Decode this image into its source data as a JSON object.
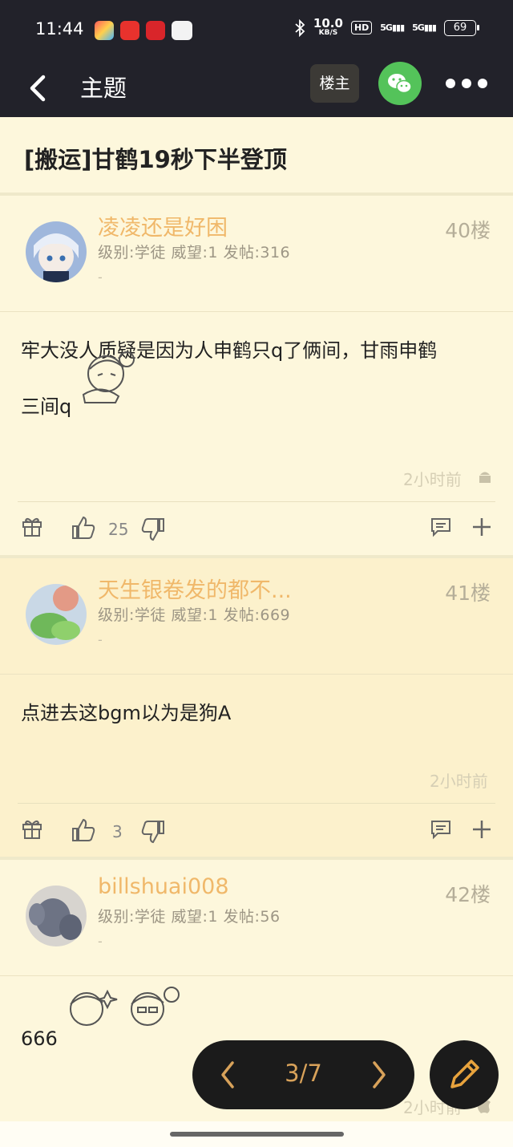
{
  "status_bar": {
    "time": "11:44",
    "net_speed_value": "10.0",
    "net_speed_unit": "KB/S",
    "hd": "HD",
    "signal1": "5G",
    "signal2": "5G",
    "battery": "69"
  },
  "nav": {
    "title": "主题",
    "owner_button": "楼主"
  },
  "topic": {
    "title": "[搬运]甘鹤19秒下半登顶"
  },
  "posts": [
    {
      "username": "凌凌还是好困",
      "floor": "40楼",
      "meta": "级别:学徒 威望:1 发帖:316",
      "dash": "-",
      "content_line1": "牢大没人质疑是因为人申鹤只q了俩间，甘雨申鹤",
      "content_line2": "三间q",
      "time": "2小时前",
      "likes": "25"
    },
    {
      "username": "天生银卷发的都不...",
      "floor": "41楼",
      "meta": "级别:学徒 威望:1 发帖:669",
      "dash": "-",
      "content_line1": "点进去这bgm以为是狗A",
      "time": "2小时前",
      "likes": "3"
    },
    {
      "username": "billshuai008",
      "floor": "42楼",
      "meta": "级别:学徒 威望:1 发帖:56",
      "dash": "-",
      "content_line1": "666",
      "time": "2小时前"
    }
  ],
  "pager": {
    "page": "3/7"
  },
  "colors": {
    "bar_bg": "#22222a",
    "page_bg": "#fdf7dc",
    "alt_bg": "#fcf1cc",
    "username": "#f0b86a",
    "accent": "#e8a33d",
    "wechat": "#54c35a"
  }
}
